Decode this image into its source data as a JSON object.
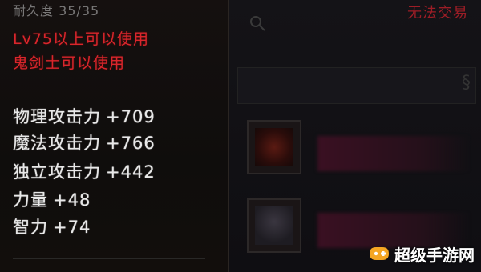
{
  "tooltip": {
    "header": "耐久度 35/35",
    "requirement_level": "Lv75以上可以使用",
    "requirement_class": "鬼剑士可以使用",
    "stats": [
      {
        "name": "物理攻击力",
        "value": "+709"
      },
      {
        "name": "魔法攻击力",
        "value": "+766"
      },
      {
        "name": "独立攻击力",
        "value": "+442"
      },
      {
        "name": "力量",
        "value": "+48"
      },
      {
        "name": "智力",
        "value": "+74"
      }
    ]
  },
  "right_panel": {
    "top_label": "无法交易"
  },
  "watermark": {
    "text": "超级手游网"
  },
  "colors": {
    "requirement_red": "#d9262c",
    "stat_white": "#e8e8e8",
    "header_gray": "#9a9a9a"
  }
}
